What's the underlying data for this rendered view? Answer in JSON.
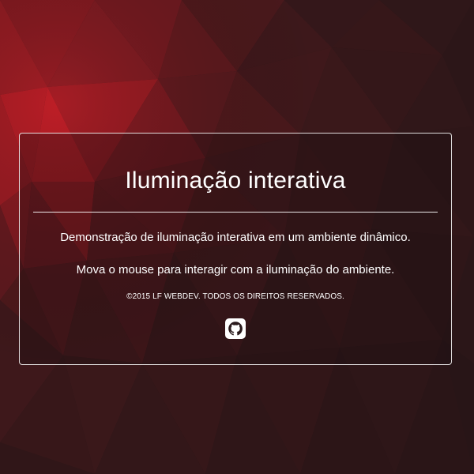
{
  "colors": {
    "background_dark": "#2a1a1c",
    "accent_red": "#b01c24",
    "text": "#ffffff"
  },
  "panel": {
    "title": "Iluminação interativa",
    "description": "Demonstração de iluminação interativa em um ambiente dinâmico.",
    "hint": "Mova o mouse para interagir com a iluminação do ambiente.",
    "copyright": "©2015 LF WEBDEV. TODOS OS DIREITOS RESERVADOS.",
    "github_icon": "github-icon"
  }
}
